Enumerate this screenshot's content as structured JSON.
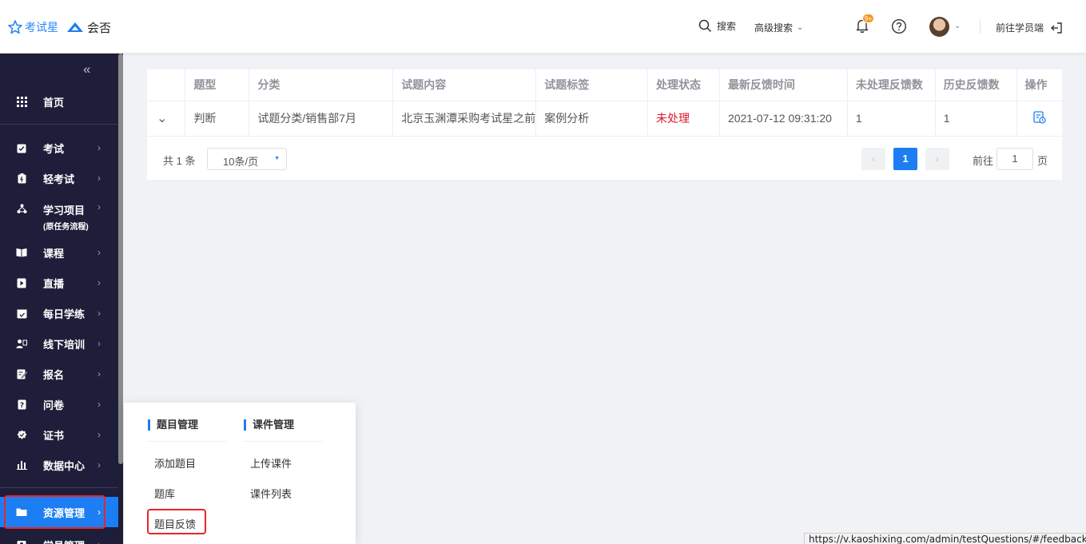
{
  "header": {
    "brand1": "考试星",
    "brand2": "会否",
    "search_label": "搜索",
    "adv_search_label": "高级搜索",
    "notification_badge": "9+",
    "goto_student_label": "前往学员端"
  },
  "sidebar": {
    "home": "首页",
    "items": [
      {
        "label": "考试",
        "icon": "exam-icon"
      },
      {
        "label": "轻考试",
        "icon": "light-exam-icon"
      },
      {
        "label": "学习项目",
        "sub": "(原任务流程)",
        "icon": "project-icon"
      },
      {
        "label": "课程",
        "icon": "course-icon"
      },
      {
        "label": "直播",
        "icon": "live-icon"
      },
      {
        "label": "每日学练",
        "icon": "daily-practice-icon"
      },
      {
        "label": "线下培训",
        "icon": "offline-training-icon"
      },
      {
        "label": "报名",
        "icon": "signup-icon"
      },
      {
        "label": "问卷",
        "icon": "survey-icon"
      },
      {
        "label": "证书",
        "icon": "certificate-icon"
      },
      {
        "label": "数据中心",
        "icon": "data-center-icon"
      },
      {
        "label": "资源管理",
        "icon": "folder-icon",
        "active": true
      },
      {
        "label": "学员管理",
        "icon": "student-icon"
      }
    ]
  },
  "table": {
    "columns": [
      "",
      "题型",
      "分类",
      "试题内容",
      "试题标签",
      "处理状态",
      "最新反馈时间",
      "未处理反馈数",
      "历史反馈数",
      "操作"
    ],
    "rows": [
      {
        "type": "判断",
        "category": "试题分类/销售部7月",
        "content": "北京玉渊潭采购考试星之前",
        "tag": "案例分析",
        "status": "未处理",
        "latest_time": "2021-07-12 09:31:20",
        "unprocessed": "1",
        "history": "1"
      }
    ]
  },
  "pagination": {
    "total": "共 1 条",
    "page_size": "10条/页",
    "current_page": "1",
    "goto_label": "前往",
    "goto_value": "1",
    "page_suffix": "页"
  },
  "flyout": {
    "group1": {
      "title": "题目管理",
      "items": [
        "添加题目",
        "题库",
        "题目反馈"
      ]
    },
    "group2": {
      "title": "课件管理",
      "items": [
        "上传课件",
        "课件列表"
      ]
    }
  },
  "status_bar_url": "https://v.kaoshixing.com/admin/testQuestions/#/feedback",
  "colors": {
    "primary": "#1c7ef2",
    "sidebar_bg": "#1f1e3a",
    "status_red": "#e0162c",
    "highlight_red": "#e8262a",
    "badge_orange": "#f79622"
  }
}
